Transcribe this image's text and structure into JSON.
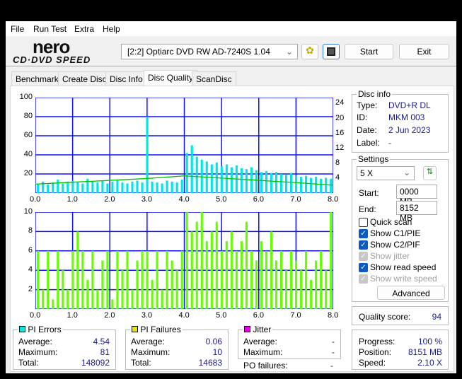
{
  "menu": [
    "File",
    "Run Test",
    "Extra",
    "Help"
  ],
  "logo": {
    "top": "nero",
    "bottom": "CD·DVD SPEED"
  },
  "drive": "[2:2]  Optiarc DVD RW AD-7240S 1.04",
  "buttons": {
    "start": "Start",
    "exit": "Exit",
    "advanced": "Advanced"
  },
  "tabs": [
    "Benchmark",
    "Create Disc",
    "Disc Info",
    "Disc Quality",
    "ScanDisc"
  ],
  "active_tab": "Disc Quality",
  "disc_info": {
    "title": "Disc info",
    "type_label": "Type:",
    "type": "DVD+R DL",
    "id_label": "ID:",
    "id": "MKM 003",
    "date_label": "Date:",
    "date": "2 Jun 2023",
    "label_label": "Label:",
    "label": "-"
  },
  "settings": {
    "title": "Settings",
    "speed": "5 X",
    "start_label": "Start:",
    "start": "0000 MB",
    "end_label": "End:",
    "end": "8152 MB",
    "checks": [
      {
        "label": "Quick scan",
        "state": "off"
      },
      {
        "label": "Show C1/PIE",
        "state": "on"
      },
      {
        "label": "Show C2/PIF",
        "state": "on"
      },
      {
        "label": "Show jitter",
        "state": "disabled"
      },
      {
        "label": "Show read speed",
        "state": "on"
      },
      {
        "label": "Show write speed",
        "state": "disabled"
      }
    ]
  },
  "quality": {
    "label": "Quality score:",
    "value": "94"
  },
  "pi_errors": {
    "title": "PI Errors",
    "avg_label": "Average:",
    "avg": "4.54",
    "max_label": "Maximum:",
    "max": "81",
    "total_label": "Total:",
    "total": "148092",
    "color": "#00e5e5"
  },
  "pi_failures": {
    "title": "PI Failures",
    "avg_label": "Average:",
    "avg": "0.06",
    "max_label": "Maximum:",
    "max": "10",
    "total_label": "Total:",
    "total": "14683",
    "color": "#e5e500"
  },
  "jitter": {
    "title": "Jitter",
    "avg_label": "Average:",
    "avg": "-",
    "max_label": "Maximum:",
    "max": "-",
    "color": "#e500e5"
  },
  "po_failures": {
    "label": "PO failures:",
    "value": "-"
  },
  "progress": {
    "progress_label": "Progress:",
    "progress": "100 %",
    "position_label": "Position:",
    "position": "8151 MB",
    "speed_label": "Speed:",
    "speed": "2.10 X"
  },
  "chart_data": [
    {
      "type": "bar",
      "name": "pi-errors",
      "xlim": [
        0,
        8
      ],
      "ylim": [
        0,
        100
      ],
      "y2lim": [
        0,
        25.6
      ],
      "xticks": [
        "0.0",
        "1.0",
        "2.0",
        "3.0",
        "4.0",
        "5.0",
        "6.0",
        "7.0",
        "8.0"
      ],
      "yticks": [
        "100",
        "80",
        "60",
        "40",
        "20"
      ],
      "y2ticks": [
        "24",
        "20",
        "16",
        "12",
        "8",
        "4"
      ],
      "values": [
        10,
        12,
        9,
        11,
        14,
        10,
        12,
        13,
        11,
        10,
        15,
        12,
        11,
        13,
        10,
        12,
        14,
        11,
        10,
        12,
        13,
        11,
        80,
        12,
        11,
        10,
        13,
        12,
        11,
        14,
        42,
        50,
        38,
        35,
        33,
        30,
        32,
        28,
        30,
        27,
        29,
        26,
        25,
        27,
        24,
        22,
        23,
        21,
        22,
        20,
        19,
        21,
        18,
        17,
        18,
        16,
        17,
        15,
        16,
        15
      ],
      "bar_color": "#00e5e5",
      "speed": {
        "x": [
          0,
          1,
          2,
          3,
          4,
          5,
          6,
          7,
          8
        ],
        "y": [
          2.4,
          2.9,
          3.4,
          3.9,
          4.6,
          4.0,
          3.4,
          2.8,
          2.1
        ],
        "color": "#00c000"
      }
    },
    {
      "type": "bar",
      "name": "pi-failures",
      "xlim": [
        0,
        8
      ],
      "ylim": [
        0,
        10
      ],
      "xticks": [
        "0.0",
        "1.0",
        "2.0",
        "3.0",
        "4.0",
        "5.0",
        "6.0",
        "7.0",
        "8.0"
      ],
      "yticks": [
        "10",
        "8",
        "6",
        "4",
        "2"
      ],
      "values": [
        6,
        2,
        6,
        1,
        6,
        4,
        2,
        6,
        8,
        6,
        3,
        6,
        2,
        5,
        6,
        1,
        6,
        4,
        6,
        2,
        5,
        6,
        6,
        3,
        6,
        2,
        6,
        5,
        4,
        6,
        10,
        8,
        9,
        10,
        7,
        8,
        9,
        6,
        7,
        8,
        6,
        7,
        9,
        6,
        5,
        7,
        6,
        8,
        5,
        6,
        4,
        6,
        5,
        4,
        6,
        3,
        5,
        6,
        4,
        10
      ],
      "bar_color": "#66ff00"
    }
  ]
}
